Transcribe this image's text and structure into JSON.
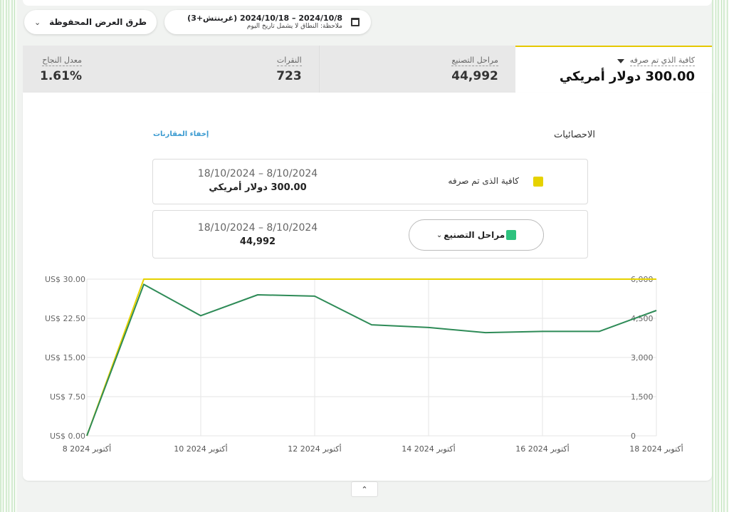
{
  "toolbar": {
    "saved_views_label": "طرق العرض المحفوظة",
    "date_range": "2024/10/8 – 2024/10/18 (غرينتش+3)",
    "date_note": "ملاحظة: النطاق لا يشمل تاريخ اليوم"
  },
  "metrics": [
    {
      "label": "كافية الذي تم صرفه",
      "value": "300.00 دولار أمريكي"
    },
    {
      "label": "مراحل التصنيع",
      "value": "44,992"
    },
    {
      "label": "النقرات",
      "value": "723"
    },
    {
      "label": "معدل النجاح",
      "value": "1.61%"
    }
  ],
  "stats": {
    "title": "الاحصائيات",
    "hide_comparisons": "إخفاء المقارنات",
    "rows": [
      {
        "label": "كافية الذى تم صرفه",
        "dates": "18/10/2024 – 8/10/2024",
        "value": "300.00 دولار أمريكي"
      },
      {
        "label": "مراحل التصنيع",
        "dates": "18/10/2024 – 8/10/2024",
        "value": "44,992"
      }
    ]
  },
  "colors": {
    "spend": "#e6d200",
    "production": "#2e8b57",
    "accent": "#e6c700"
  },
  "chart_data": {
    "type": "line",
    "x": [
      "2024-10-08",
      "2024-10-09",
      "2024-10-10",
      "2024-10-11",
      "2024-10-12",
      "2024-10-13",
      "2024-10-14",
      "2024-10-15",
      "2024-10-16",
      "2024-10-17",
      "2024-10-18"
    ],
    "x_tick_labels": [
      "8 أكتوبر 2024",
      "10 أكتوبر 2024",
      "12 أكتوبر 2024",
      "14 أكتوبر 2024",
      "16 أكتوبر 2024",
      "18 أكتوبر 2024"
    ],
    "series": [
      {
        "name": "كافية الذى تم صرفه",
        "axis": "left",
        "values": [
          0,
          30,
          30,
          30,
          30,
          30,
          30,
          30,
          30,
          30,
          30
        ]
      },
      {
        "name": "مراحل التصنيع",
        "axis": "right",
        "values": [
          0,
          5800,
          4600,
          5400,
          5350,
          4250,
          4150,
          3950,
          4000,
          4000,
          4800
        ]
      }
    ],
    "y_left_ticks": [
      "US$ 0.00",
      "US$ 7.50",
      "US$ 15.00",
      "US$ 22.50",
      "US$ 30.00"
    ],
    "y_left_lim": [
      0,
      30
    ],
    "y_right_ticks": [
      "0",
      "1,500",
      "3,000",
      "4,500",
      "6,000"
    ],
    "y_right_lim": [
      0,
      6000
    ],
    "grid": true
  }
}
